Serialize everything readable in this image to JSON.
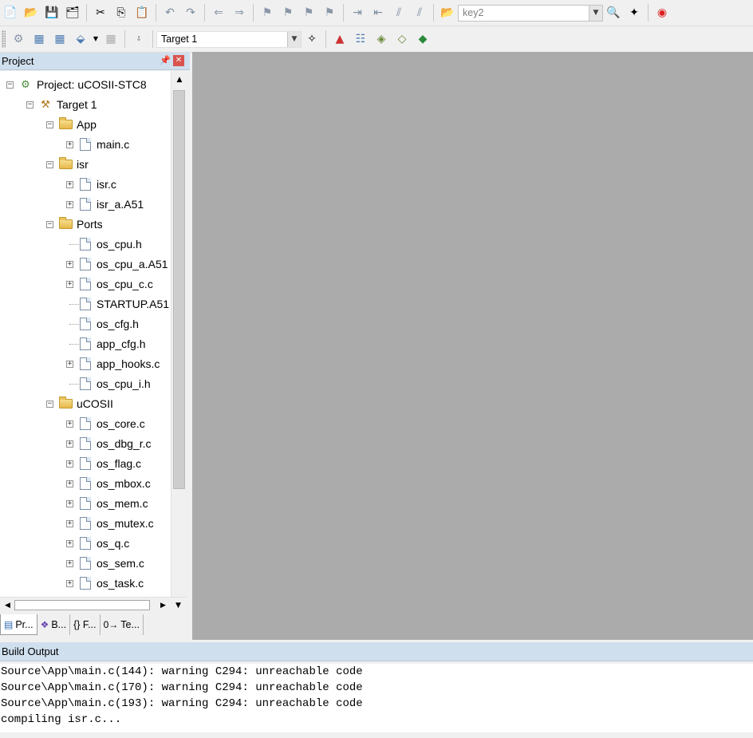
{
  "toolbar1": {
    "build_target_value": "key2"
  },
  "toolbar2": {
    "target_value": "Target 1"
  },
  "project_panel": {
    "title": "Project",
    "tree": [
      {
        "label": "Project: uCOSII-STC8",
        "level": 0,
        "kind": "project",
        "expander": "minus"
      },
      {
        "label": "Target 1",
        "level": 1,
        "kind": "target",
        "expander": "minus"
      },
      {
        "label": "App",
        "level": 2,
        "kind": "folder",
        "expander": "minus"
      },
      {
        "label": "main.c",
        "level": 3,
        "kind": "file",
        "expander": "plus"
      },
      {
        "label": "isr",
        "level": 2,
        "kind": "folder",
        "expander": "minus"
      },
      {
        "label": "isr.c",
        "level": 3,
        "kind": "file",
        "expander": "plus"
      },
      {
        "label": "isr_a.A51",
        "level": 3,
        "kind": "file",
        "expander": "plus"
      },
      {
        "label": "Ports",
        "level": 2,
        "kind": "folder",
        "expander": "minus"
      },
      {
        "label": "os_cpu.h",
        "level": 3,
        "kind": "file",
        "expander": "none"
      },
      {
        "label": "os_cpu_a.A51",
        "level": 3,
        "kind": "file",
        "expander": "plus"
      },
      {
        "label": "os_cpu_c.c",
        "level": 3,
        "kind": "file",
        "expander": "plus"
      },
      {
        "label": "STARTUP.A51",
        "level": 3,
        "kind": "file",
        "expander": "none"
      },
      {
        "label": "os_cfg.h",
        "level": 3,
        "kind": "file",
        "expander": "none"
      },
      {
        "label": "app_cfg.h",
        "level": 3,
        "kind": "file",
        "expander": "none"
      },
      {
        "label": "app_hooks.c",
        "level": 3,
        "kind": "file",
        "expander": "plus"
      },
      {
        "label": "os_cpu_i.h",
        "level": 3,
        "kind": "file",
        "expander": "none"
      },
      {
        "label": "uCOSII",
        "level": 2,
        "kind": "folder",
        "expander": "minus"
      },
      {
        "label": "os_core.c",
        "level": 3,
        "kind": "file",
        "expander": "plus"
      },
      {
        "label": "os_dbg_r.c",
        "level": 3,
        "kind": "file",
        "expander": "plus"
      },
      {
        "label": "os_flag.c",
        "level": 3,
        "kind": "file",
        "expander": "plus"
      },
      {
        "label": "os_mbox.c",
        "level": 3,
        "kind": "file",
        "expander": "plus"
      },
      {
        "label": "os_mem.c",
        "level": 3,
        "kind": "file",
        "expander": "plus"
      },
      {
        "label": "os_mutex.c",
        "level": 3,
        "kind": "file",
        "expander": "plus"
      },
      {
        "label": "os_q.c",
        "level": 3,
        "kind": "file",
        "expander": "plus"
      },
      {
        "label": "os_sem.c",
        "level": 3,
        "kind": "file",
        "expander": "plus"
      },
      {
        "label": "os_task.c",
        "level": 3,
        "kind": "file",
        "expander": "plus"
      }
    ],
    "tabs": [
      {
        "icon": "project-tab-icon",
        "label": "Pr..."
      },
      {
        "icon": "books-tab-icon",
        "label": "B..."
      },
      {
        "icon": "functions-tab-icon",
        "label": "{} F..."
      },
      {
        "icon": "templates-tab-icon",
        "label": "Te..."
      }
    ]
  },
  "build_output": {
    "title": "Build Output",
    "lines": [
      "Source\\App\\main.c(144): warning C294: unreachable code",
      "Source\\App\\main.c(170): warning C294: unreachable code",
      "Source\\App\\main.c(193): warning C294: unreachable code",
      "compiling isr.c..."
    ]
  },
  "colors": {
    "workspace": "#ababab",
    "panel_header": "#cfdfee"
  }
}
